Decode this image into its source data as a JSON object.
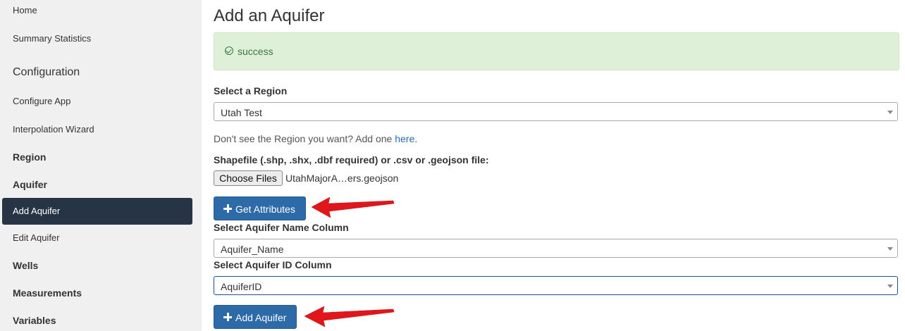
{
  "sidebar": {
    "home": "Home",
    "summary_statistics": "Summary Statistics",
    "configuration_heading": "Configuration",
    "configure_app": "Configure App",
    "interpolation_wizard": "Interpolation Wizard",
    "region": "Region",
    "aquifer": "Aquifer",
    "add_aquifer": "Add Aquifer",
    "edit_aquifer": "Edit Aquifer",
    "wells": "Wells",
    "measurements": "Measurements",
    "variables": "Variables"
  },
  "main": {
    "title": "Add an Aquifer",
    "alert": {
      "icon": "check-circle-icon",
      "message": "success",
      "color": "#3c763d"
    },
    "region_label": "Select a Region",
    "region_value": "Utah Test",
    "hint_text": "Don't see the Region you want? Add one ",
    "hint_link": "here",
    "hint_end": ".",
    "file_label": "Shapefile (.shp, .shx, .dbf required) or .csv or .geojson file:",
    "file_button": "Choose Files",
    "file_name": "UtahMajorA…ers.geojson",
    "get_attributes_button": "Get Attributes",
    "name_column_label": "Select Aquifer Name Column",
    "name_column_value": "Aquifer_Name",
    "id_column_label": "Select Aquifer ID Column",
    "id_column_value": "AquiferID",
    "add_aquifer_button": "Add Aquifer"
  },
  "colors": {
    "sidebar_bg": "#f0f0f0",
    "active_bg": "#263445",
    "primary_button": "#2d6aa8",
    "annotation_arrow": "#e0161b"
  }
}
